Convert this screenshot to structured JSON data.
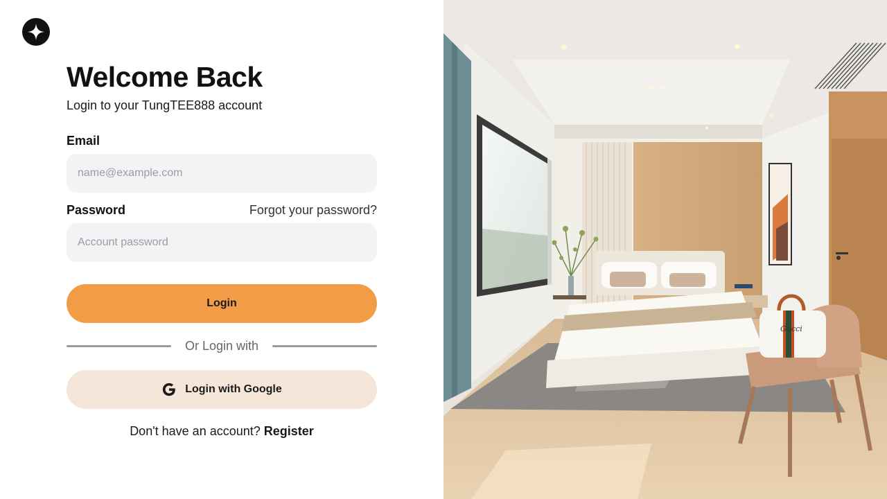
{
  "login": {
    "title": "Welcome Back",
    "subtitle": "Login to your TungTEE888 account",
    "email_label": "Email",
    "email_placeholder": "name@example.com",
    "email_value": "",
    "password_label": "Password",
    "forgot_link": "Forgot your password?",
    "password_placeholder": "Account password",
    "password_value": "",
    "login_button": "Login",
    "divider_text": "Or Login with",
    "google_button": "Login with Google",
    "register_prompt": "Don't have an account?",
    "register_link": "Register"
  },
  "icons": {
    "logo": "four-point-star-icon",
    "google": "google-g-icon"
  },
  "colors": {
    "accent": "#f39c47",
    "google_button_bg": "#f5e6da",
    "input_bg": "#f2f3f5"
  },
  "illustration": {
    "bag_text": "Gucci"
  }
}
